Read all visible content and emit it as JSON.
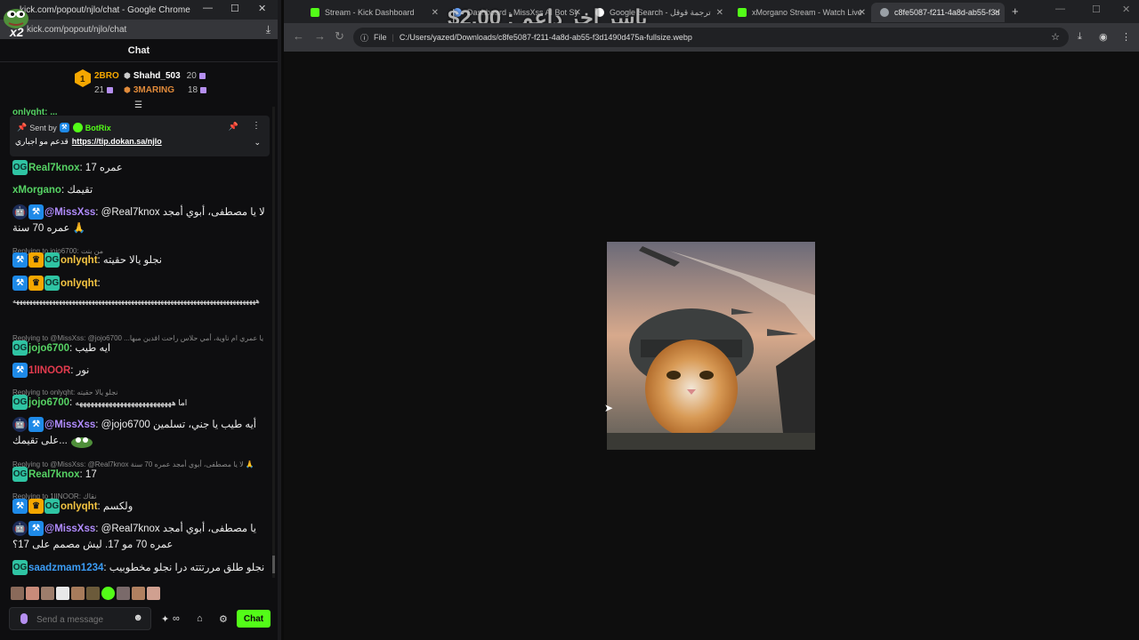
{
  "chat_window": {
    "title": "kick.com/popout/njlo/chat - Google Chrome",
    "url": "kick.com/popout/njlo/chat",
    "overlay_multiplier": "x2",
    "header": "Chat",
    "leaderboard": [
      {
        "name": "2BRO",
        "count": "21"
      },
      {
        "name": "Shahd_503",
        "count": "20"
      },
      {
        "name": "3MARING",
        "count": "18"
      }
    ],
    "pinned": {
      "sent_by_label": "Sent by",
      "sender": "BotRix",
      "text": "قدعم مو اجباري",
      "link": "https://tip.dokan.sa/njlo"
    },
    "partial_top": "onlyqht: ...",
    "messages": [
      {
        "user": "Real7knox",
        "text": "عمره 17"
      },
      {
        "user": "xMorgano",
        "text": "تقيمك"
      },
      {
        "user": "@MissXss",
        "text": "@Real7knox لا يا مصطفى، أبوي أمجد عمره 70 سنة 🙏"
      },
      {
        "reply": "Replying to jojo6700: من بنت"
      },
      {
        "user": "onlyqht",
        "text": "نجلو يالا حقيته"
      },
      {
        "user": "onlyqht",
        "text": "ههههههههههههههههههههههههههههههههههههههههههههههههههههههههههههههههههههههههههه"
      },
      {
        "reply": "Replying to @MissXss: @jojo6700 ...يا عمري ام ناوية، أمي حلاس راحت اقدين مبها"
      },
      {
        "user": "jojo6700",
        "text": "ايه طيب"
      },
      {
        "user": "1lINOOR",
        "text": "نور"
      },
      {
        "reply": "Replying to onlyqht: نجلو يالا حقيته"
      },
      {
        "user": "jojo6700",
        "text": "اما ههههههههههههههههههههههههههه"
      },
      {
        "user": "@MissXss",
        "text": "@jojo6700 أيه طيب يا جني، تسلمين على تقيمك..."
      },
      {
        "reply": "Replying to @MissXss: @Real7knox لا يا مصطفى، أبوي أمجد عمره 70 سنة 🙏"
      },
      {
        "user": "Real7knox",
        "text": "17"
      },
      {
        "reply": "Replying to 1lINOOR: نقاك"
      },
      {
        "user": "onlyqht",
        "text": "ولكسم"
      },
      {
        "user": "@MissXss",
        "text": "@Real7knox يا مصطفى، أبوي أمجد عمره 70 مو 17. ليش مصمم على 17؟"
      },
      {
        "user": "saadzmam1234",
        "text": "نجلو طلق مررتتته درا نجلو مخطوبيب"
      }
    ],
    "input_placeholder": "Send a message",
    "send_label": "Chat",
    "tool_infinity": "∞"
  },
  "browser": {
    "tabs": [
      {
        "title": "Stream - Kick Dashboard"
      },
      {
        "title": "Dashboard - MissXss AI Bot Sy"
      },
      {
        "title": "Google Search - ترجمة قوقل"
      },
      {
        "title": "xMorgano Stream - Watch Live"
      },
      {
        "title": "c8fe5087-f211-4a8d-ab55-f3d"
      }
    ],
    "overlay_text": "$2.00 : ياسر اخر داعم",
    "omnibox_chip": "File",
    "url": "C:/Users/yazed/Downloads/c8fe5087-f211-4a8d-ab55-f3d1490d475a-fullsize.webp"
  },
  "colors": {
    "kick_green": "#53fc18",
    "mod_blue": "#1e8ae8",
    "vip_gold": "#f5a700",
    "og_teal": "#2fc4a3",
    "missxss_purple": "#b18cff",
    "username_green": "#56d364",
    "jojo_green": "#56d364",
    "nour_red": "#e33b4e",
    "saad_blue": "#3b9cf5"
  }
}
